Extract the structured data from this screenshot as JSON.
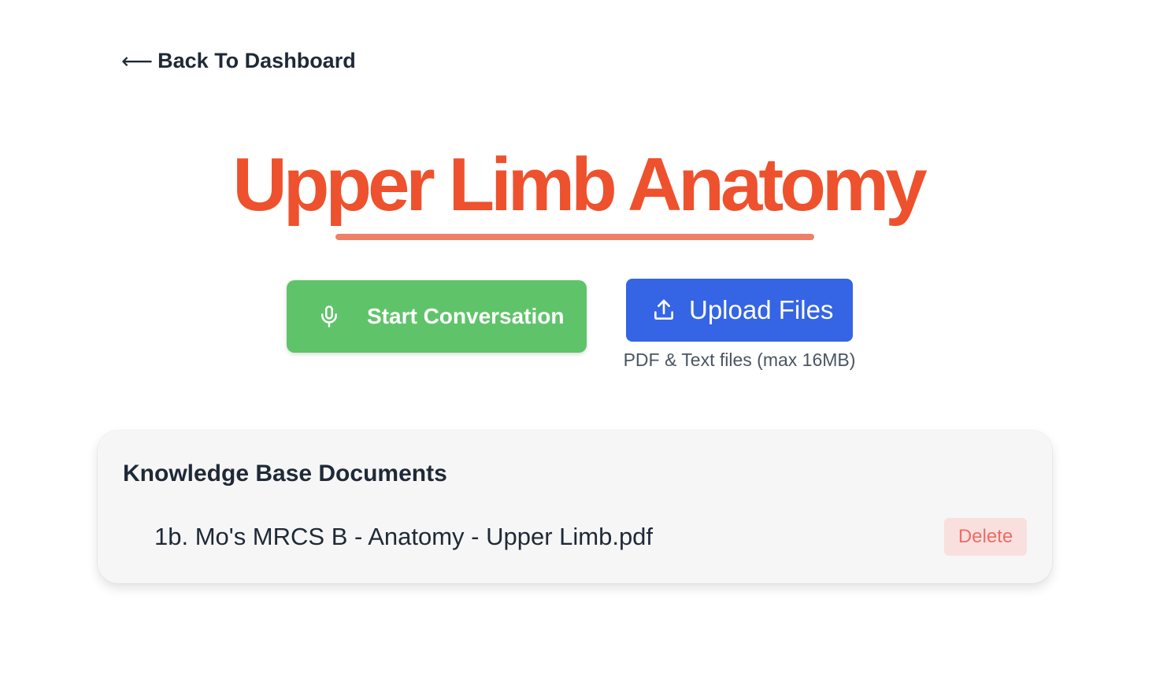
{
  "nav": {
    "back_arrow": "⟵",
    "back_label": "Back To Dashboard"
  },
  "header": {
    "title": "Upper Limb Anatomy"
  },
  "actions": {
    "start_label": "Start Conversation",
    "start_icon": "microphone-icon",
    "upload_label": "Upload Files",
    "upload_icon": "upload-icon",
    "upload_hint": "PDF & Text files (max 16MB)"
  },
  "knowledge_base": {
    "title": "Knowledge Base Documents",
    "documents": [
      {
        "name": "1b. Mo's MRCS B - Anatomy - Upper Limb.pdf",
        "delete_label": "Delete"
      }
    ]
  },
  "colors": {
    "title": "#ee512d",
    "underline": "#ef8068",
    "start_button": "#5fc36a",
    "upload_button": "#3565e4",
    "delete_text": "#ef6b66",
    "delete_bg": "#f9e0de"
  }
}
